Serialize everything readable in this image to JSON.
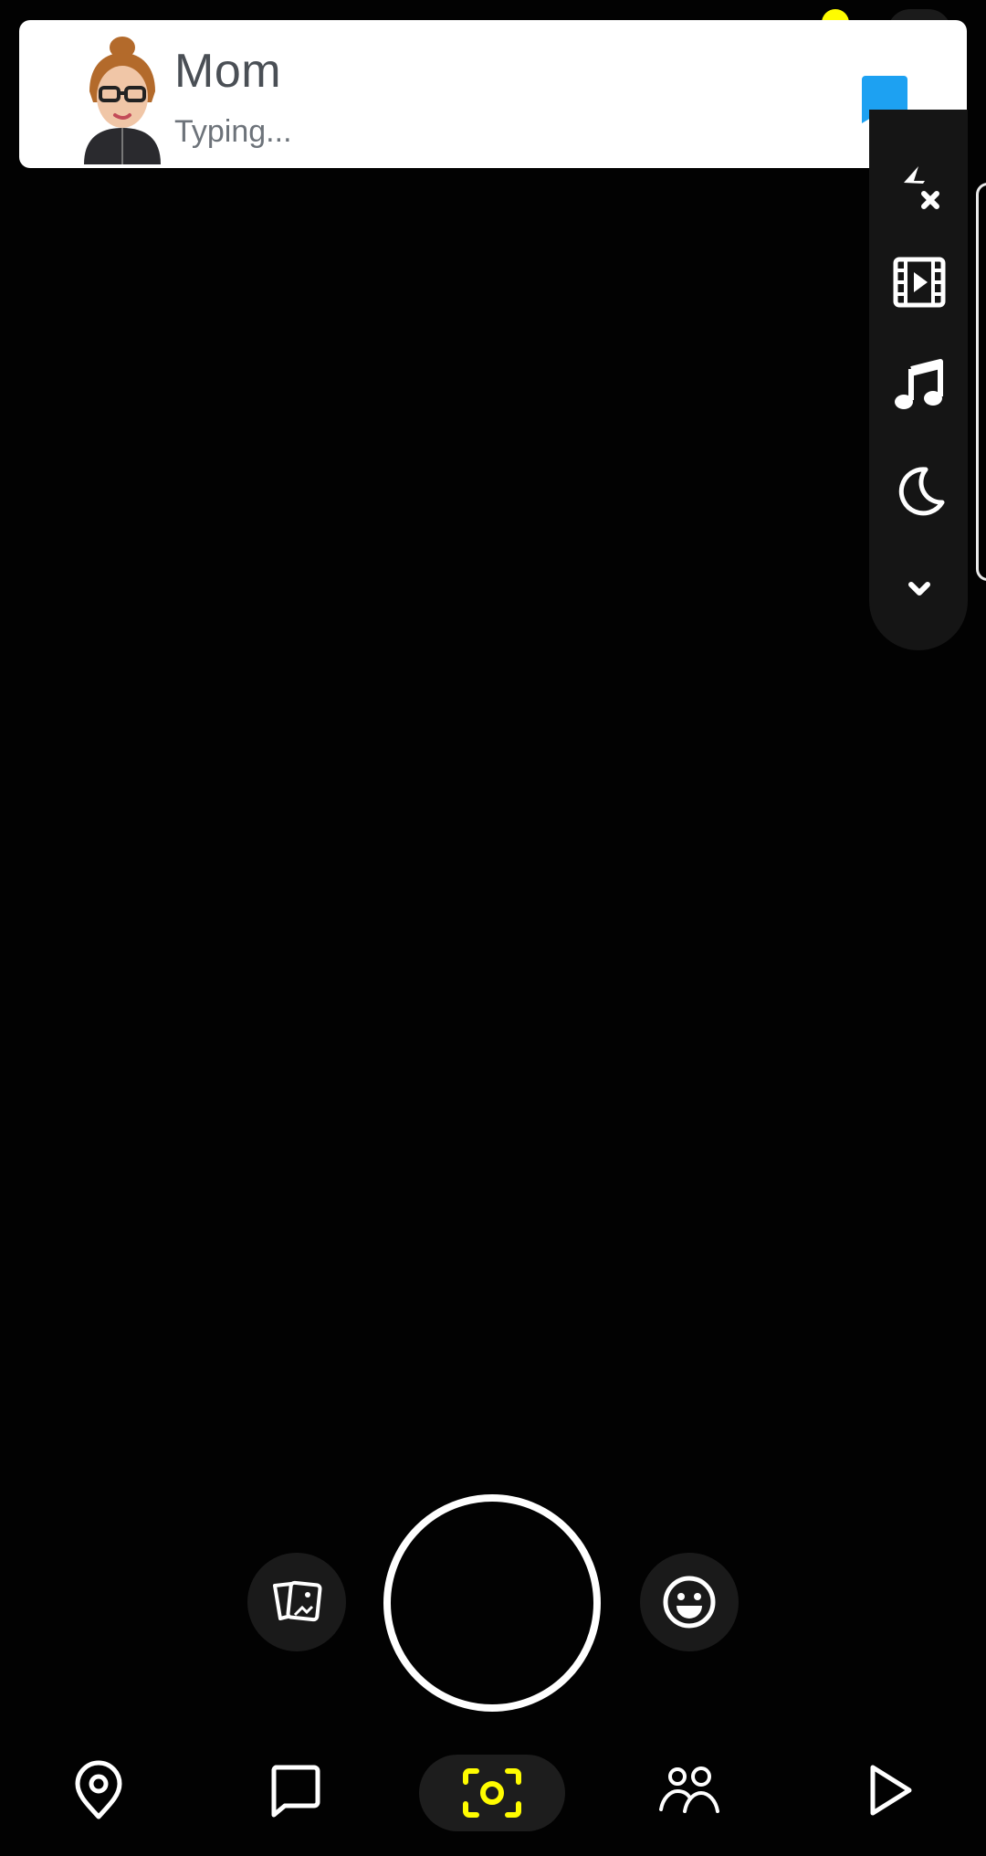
{
  "notification": {
    "sender": "Mom",
    "status": "Typing...",
    "avatar_icon": "bitmoji-avatar-icon",
    "chat_icon": "chat-bubble-icon",
    "chat_icon_color": "#1DA1F2"
  },
  "camera_tools": [
    {
      "icon": "flash-off-icon"
    },
    {
      "icon": "video-filter-icon"
    },
    {
      "icon": "music-note-icon"
    },
    {
      "icon": "night-mode-icon"
    },
    {
      "icon": "chevron-down-icon"
    }
  ],
  "capture_controls": {
    "left_button_icon": "memories-icon",
    "shutter_icon": "shutter-ring",
    "right_button_icon": "lenses-smiley-icon"
  },
  "bottom_nav": [
    {
      "icon": "map-pin-icon"
    },
    {
      "icon": "chat-icon"
    },
    {
      "icon": "camera-icon",
      "active": true,
      "color": "#FFFC00"
    },
    {
      "icon": "friends-icon"
    },
    {
      "icon": "play-icon"
    }
  ],
  "colors": {
    "background": "#020202",
    "accent": "#FFFC00",
    "notification_background": "#FFFFFF"
  }
}
